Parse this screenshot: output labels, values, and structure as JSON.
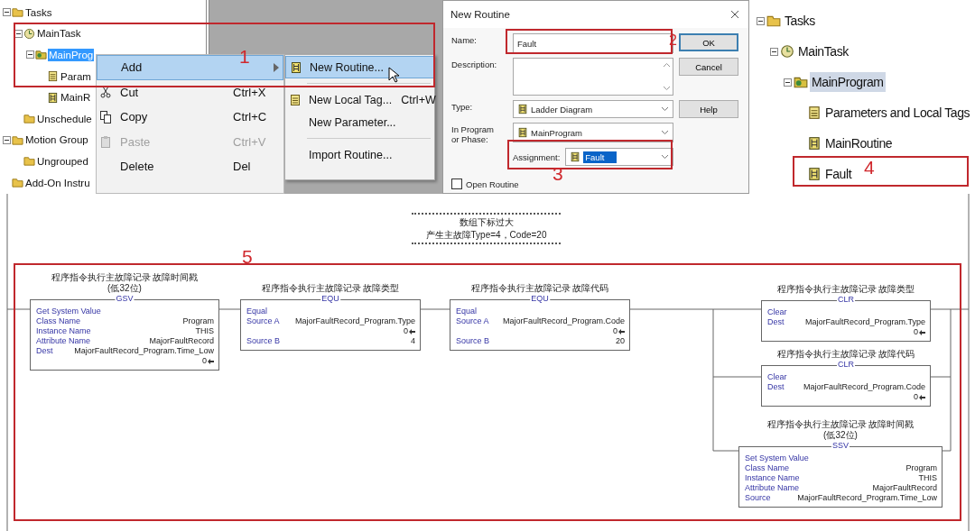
{
  "project_tree": {
    "items": [
      {
        "kind": "folder",
        "label": "Tasks",
        "selected": false,
        "children": [
          {
            "kind": "task",
            "label": "MainTask",
            "selected": false,
            "children": [
              {
                "kind": "program",
                "label": "MainProg",
                "selected": true,
                "children": [
                  {
                    "kind": "tags",
                    "label": "Param",
                    "selected": false
                  },
                  {
                    "kind": "routine",
                    "label": "MainR",
                    "selected": false
                  }
                ]
              }
            ]
          },
          {
            "kind": "folder",
            "label": "Unschedule",
            "selected": false
          }
        ]
      },
      {
        "kind": "folder",
        "label": "Motion Group",
        "selected": false,
        "children": [
          {
            "kind": "folder",
            "label": "Ungrouped",
            "selected": false
          }
        ]
      },
      {
        "kind": "folder",
        "label": "Add-On Instru",
        "selected": false
      }
    ]
  },
  "context_menu": {
    "items": [
      {
        "kind": "submenu",
        "label": "Add",
        "selected": true,
        "disabled": false
      },
      {
        "kind": "cut",
        "label": "Cut",
        "shortcut": "Ctrl+X",
        "selected": false,
        "disabled": false
      },
      {
        "kind": "copy",
        "label": "Copy",
        "shortcut": "Ctrl+C",
        "selected": false,
        "disabled": false
      },
      {
        "kind": "paste",
        "label": "Paste",
        "shortcut": "Ctrl+V",
        "selected": false,
        "disabled": true
      },
      {
        "kind": "plain",
        "label": "Delete",
        "shortcut": "Del",
        "selected": false,
        "disabled": false
      }
    ]
  },
  "submenu": {
    "items": [
      {
        "kind": "routine",
        "label": "New Routine...",
        "selected": true
      },
      {
        "kind": "separator"
      },
      {
        "kind": "tag",
        "label": "New Local Tag...",
        "shortcut": "Ctrl+W",
        "selected": false
      },
      {
        "kind": "plain",
        "label": "New Parameter...",
        "selected": false
      },
      {
        "kind": "separator"
      },
      {
        "kind": "plain",
        "label": "Import Routine...",
        "selected": false
      }
    ]
  },
  "dialog": {
    "title": "New Routine",
    "fields": [
      {
        "kind": "text",
        "label": "Name:",
        "value": "Fault"
      },
      {
        "kind": "textarea",
        "label": "Description:"
      },
      {
        "kind": "select",
        "label": "Type:",
        "value": "Ladder Diagram"
      },
      {
        "kind": "select",
        "label": "In Program\nor Phase:",
        "value": "MainProgram"
      },
      {
        "kind": "inline-select",
        "label": "Assignment:",
        "value": "Fault",
        "selected": true
      }
    ],
    "buttons": [
      {
        "label": "OK",
        "default": true
      },
      {
        "label": "Cancel",
        "default": false
      },
      {
        "label": "Help",
        "default": false
      }
    ],
    "open_routine": {
      "label": "Open Routine",
      "checked": false
    }
  },
  "result_tree": {
    "items": [
      {
        "kind": "folder",
        "label": "Tasks",
        "selected": false,
        "children": [
          {
            "kind": "task",
            "label": "MainTask",
            "selected": false,
            "children": [
              {
                "kind": "program",
                "label": "MainProgram",
                "selected": true,
                "children": [
                  {
                    "kind": "tags",
                    "label": "Parameters and Local Tags",
                    "selected": false
                  },
                  {
                    "kind": "routine",
                    "label": "MainRoutine",
                    "selected": false
                  },
                  {
                    "kind": "routine",
                    "label": "Fault",
                    "selected": false
                  }
                ]
              }
            ]
          }
        ]
      }
    ]
  },
  "ladder": {
    "comment": [
      "数组下标过大",
      "产生主故障Type=4，Code=20"
    ],
    "instructions": [
      {
        "mnemonic": "GSV",
        "title": "程序指令执行主故障记录 故障时间戳\n(低32位)",
        "name": "Get System Value",
        "rows": [
          {
            "label": "Class Name",
            "value": "Program"
          },
          {
            "label": "Instance Name",
            "value": "THIS"
          },
          {
            "label": "Attribute Name",
            "value": "MajorFaultRecord"
          },
          {
            "label": "Dest",
            "value": "MajorFaultRecord_Program.Time_Low",
            "live": "0"
          }
        ]
      },
      {
        "mnemonic": "EQU",
        "title": "程序指令执行主故障记录 故障类型",
        "name": "Equal",
        "rows": [
          {
            "label": "Source A",
            "value": "MajorFaultRecord_Program.Type",
            "live": "0"
          },
          {
            "label": "Source B",
            "value": "4"
          }
        ]
      },
      {
        "mnemonic": "EQU",
        "title": "程序指令执行主故障记录 故障代码",
        "name": "Equal",
        "rows": [
          {
            "label": "Source A",
            "value": "MajorFaultRecord_Program.Code",
            "live": "0"
          },
          {
            "label": "Source B",
            "value": "20"
          }
        ]
      },
      {
        "mnemonic": "CLR",
        "title": "程序指令执行主故障记录 故障类型",
        "name": "Clear",
        "rows": [
          {
            "label": "Dest",
            "value": "MajorFaultRecord_Program.Type",
            "live": "0"
          }
        ]
      },
      {
        "mnemonic": "CLR",
        "title": "程序指令执行主故障记录 故障代码",
        "name": "Clear",
        "rows": [
          {
            "label": "Dest",
            "value": "MajorFaultRecord_Program.Code",
            "live": "0"
          }
        ]
      },
      {
        "mnemonic": "SSV",
        "title": "程序指令执行主故障记录 故障时间戳\n(低32位)",
        "name": "Set System Value",
        "rows": [
          {
            "label": "Class Name",
            "value": "Program"
          },
          {
            "label": "Instance Name",
            "value": "THIS"
          },
          {
            "label": "Attribute Name",
            "value": "MajorFaultRecord"
          },
          {
            "label": "Source",
            "value": "MajorFaultRecord_Program.Time_Low"
          }
        ]
      }
    ]
  },
  "annotations": [
    {
      "label": "1"
    },
    {
      "label": "2"
    },
    {
      "label": "3"
    },
    {
      "label": "4"
    },
    {
      "label": "5"
    }
  ]
}
